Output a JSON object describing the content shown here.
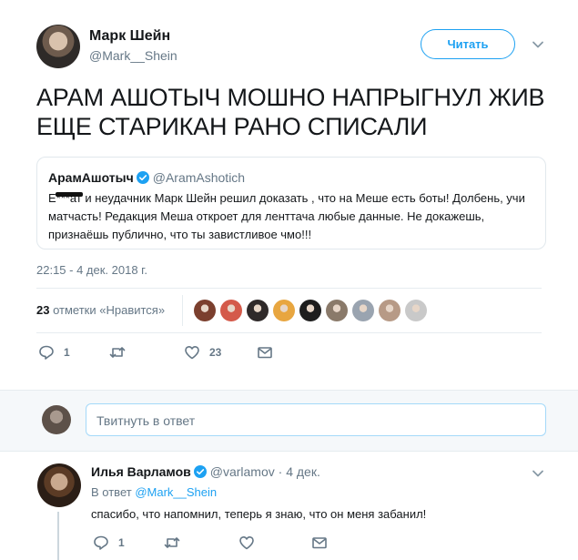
{
  "tweet": {
    "author_name": "Марк Шейн",
    "author_handle": "@Mark__Shein",
    "follow_label": "Читать",
    "text": "АРАМ АШОТЫЧ МОШНО НАПРЫГНУЛ ЖИВ ЕЩЕ СТАРИКАН РАНО СПИСАЛИ",
    "timestamp": "22:15 - 4 дек. 2018 г.",
    "likes_count": "23",
    "likes_label": "отметки «Нравится»",
    "likers": [
      "#7b3f2e",
      "#d45a4a",
      "#2f2a2a",
      "#e8a640",
      "#1e1e1e",
      "#8a7a6a",
      "#9aa4b0",
      "#b79a86",
      "#c9c9c9"
    ],
    "reply_count": "1",
    "retweet_count": "",
    "like_count": "23",
    "quote": {
      "name": "АрамАшотыч",
      "handle": "@AramAshotich",
      "text": "Е***ат и неудачник Марк Шейн решил доказать , что на Меше есть боты! Долбень, учи матчасть! Редакция Меша откроет для ленттача любые данные. Не докажешь, признаёшь публично, что ты завистливое чмо!!!"
    }
  },
  "reply_box": {
    "placeholder": "Твитнуть в ответ"
  },
  "reply": {
    "author_name": "Илья Варламов",
    "author_handle": "@varlamov",
    "date": "· 4 дек.",
    "reply_to_prefix": "В ответ",
    "reply_to_handle": "@Mark__Shein",
    "text": "спасибо, что напомнил, теперь я знаю, что он меня забанил!",
    "reply_count": "1"
  },
  "colors": {
    "accent": "#1da1f2",
    "secondary_text": "#657786",
    "border": "#e6ecf0"
  }
}
